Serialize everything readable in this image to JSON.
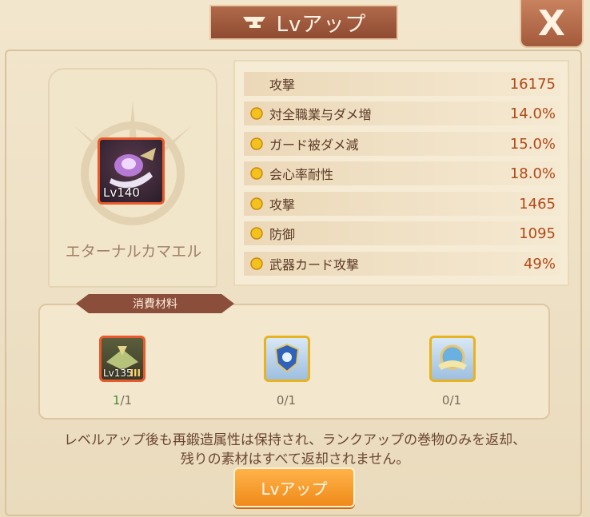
{
  "header": {
    "title": "Lvアップ",
    "close_label": "X"
  },
  "item": {
    "level": "Lv140",
    "name": "エターナルカマエル"
  },
  "stats": [
    {
      "label": "攻撃",
      "value": "16175",
      "coin": false
    },
    {
      "label": "対全職業与ダメ増",
      "value": "14.0%",
      "coin": true
    },
    {
      "label": "ガード被ダメ減",
      "value": "15.0%",
      "coin": true
    },
    {
      "label": "会心率耐性",
      "value": "18.0%",
      "coin": true
    },
    {
      "label": "攻撃",
      "value": "1465",
      "coin": true
    },
    {
      "label": "防御",
      "value": "1095",
      "coin": true
    },
    {
      "label": "武器カード攻撃",
      "value": "49%",
      "coin": true
    }
  ],
  "materials": {
    "title": "消費材料",
    "items": [
      {
        "level": "Lv135",
        "rank": "III",
        "owned": "1",
        "required": "/1"
      },
      {
        "owned": "0",
        "required": "/1"
      },
      {
        "owned": "0",
        "required": "/1"
      }
    ]
  },
  "description": {
    "line1": "レベルアップ後も再鍛造属性は保持され、ランクアップの巻物のみを返却、",
    "line2": "残りの素材はすべて返却されません。"
  },
  "button": {
    "label": "Lvアップ"
  },
  "colors": {
    "accent": "#f08a1b",
    "value": "#b04a18",
    "banner": "#8f4b32"
  }
}
